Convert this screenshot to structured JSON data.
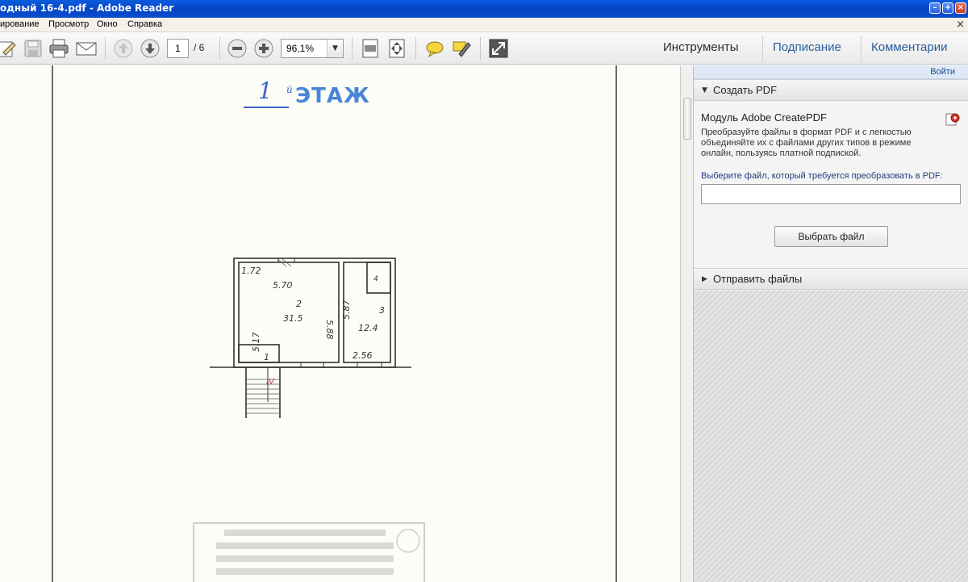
{
  "window": {
    "title": "одный 16-4.pdf - Adobe Reader",
    "minimize": "–",
    "maximize": "+",
    "close": "×"
  },
  "menu": {
    "items": [
      "ирование",
      "Просмотр",
      "Окно",
      "Справка"
    ],
    "close_glyph": "×"
  },
  "toolbar": {
    "page_current": "1",
    "page_total": "/ 6",
    "zoom": "96,1%",
    "zoom_dropdown_glyph": "▼",
    "tabs": [
      "Инструменты",
      "Подписание",
      "Комментарии"
    ]
  },
  "document": {
    "floor_number": "1",
    "floor_suffix": "й",
    "floor_label": "ЭТАЖ",
    "plan_labels": {
      "dim_172": "1.72",
      "dim_570": "5.70",
      "room_2": "2",
      "area_315": "31.5",
      "dim_588": "5.88",
      "dim_587": "5.87",
      "dim_517": "5.17",
      "room_3": "3",
      "area_124": "12.4",
      "room_1": "1",
      "room_4": "4",
      "dim_256": "2.56",
      "entrance": "IV"
    }
  },
  "panel": {
    "login": "Войти",
    "create_pdf_header": "Создать PDF",
    "module_title": "Модуль Adobe CreatePDF",
    "module_desc": "Преобразуйте файлы в формат PDF и с легкостью объединяйте их с файлами других типов в режиме онлайн, пользуясь платной подпиской.",
    "choose_label": "Выберите файл, который требуется преобразовать в PDF:",
    "choose_button": "Выбрать файл",
    "send_files_header": "Отправить файлы",
    "expanded_arrow": "▼",
    "collapsed_arrow": "▶"
  },
  "colors": {
    "titlebar": "#0444c2",
    "floor_ink": "#3e61c9",
    "link": "#1b4b8c",
    "tab_accent": "#2a5d9a"
  },
  "icons": [
    "edit-icon",
    "save-icon",
    "print-icon",
    "email-icon",
    "page-up-icon",
    "page-down-icon",
    "zoom-out-icon",
    "zoom-in-icon",
    "fit-page-icon",
    "fit-width-icon",
    "comment-icon",
    "highlight-icon",
    "fullscreen-icon",
    "createpdf-icon"
  ]
}
